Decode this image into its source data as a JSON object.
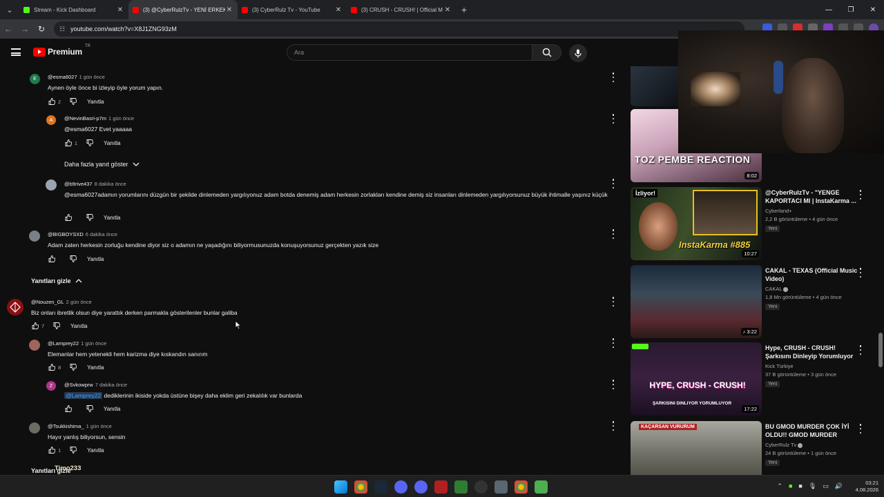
{
  "browser": {
    "tabs": [
      {
        "title": "Stream - Kick Dashboard",
        "favicon": "kick-icon",
        "active": false
      },
      {
        "title": "(3) @CyberRulzTv - YENİ ERKEK",
        "favicon": "youtube-icon",
        "active": true
      },
      {
        "title": "(3) CyberRulz Tv - YouTube",
        "favicon": "youtube-icon",
        "active": false
      },
      {
        "title": "(3) CRUSH - CRUSH! | Official M",
        "favicon": "youtube-icon",
        "active": false
      }
    ],
    "url": "youtube.com/watch?v=X8J1ZNG93zM"
  },
  "masthead": {
    "logo_word": "Premium",
    "country_code": "TR",
    "search_placeholder": "Ara"
  },
  "comments": [
    {
      "author": "@esma6027",
      "time": "1 gün önce",
      "text": "Aynen öyle önce bi izleyip öyle yorum yapın.",
      "likes": "2",
      "reply": "Yanıtla",
      "avatar_letter": "E",
      "avatar_color": "#1e7a4c"
    },
    {
      "author": "@NevinBasri-p7m",
      "time": "1 gün önce",
      "text": "@esma6027 Evet yaaaaa",
      "likes": "1",
      "reply": "Yanıtla",
      "avatar_letter": "A",
      "avatar_color": "#e0741f"
    },
    {
      "author": "@b9rive437",
      "time": "8 dakika önce",
      "text": "@esma6027adamın yorumlarını düzgün bir şekilde dinlemeden yargılıyonuz adam botda denemiş adam herkesin zorlakları kendine demiş siz insanları dinlemeden yargılıyorsunuz büyük ihtimalle yaşınız küçük",
      "likes": "",
      "reply": "Yanıtla"
    },
    {
      "author": "@BIGBOYSXD",
      "time": "6 dakika önce",
      "text": "Adam zaten herkesin zorluğu kendine diyor siz o adamın ne yaşadığını biliyormusunuzda konuşuyorsunuz gerçekten yazık size",
      "likes": "",
      "reply": "Yanıtla"
    },
    {
      "author": "@Nouzen_GL",
      "time": "2 gün önce",
      "text": "Biz onları ibretlik olsun diye yarattık derken parmakla gösterilenler bunlar galiba",
      "likes": "7",
      "reply": "Yanıtla"
    },
    {
      "author": "@Lamprey22",
      "time": "1 gün önce",
      "text": "Elemanlar hem yetenekli hem karizma diye kıskandın sanırım",
      "likes": "8",
      "reply": "Yanıtla"
    },
    {
      "author": "@Svkowprw",
      "time": "7 dakika önce",
      "mention": "@Lamprey22",
      "text": "dediklerinin ikiside yokda üstüne bişey daha eklim geri zekalılık var bunlarda",
      "likes": "",
      "reply": "Yanıtla",
      "avatar_letter": "Z",
      "avatar_color": "#b0338a"
    },
    {
      "author": "@Tsukkishima_",
      "time": "1 gün önce",
      "text": "Hayır yanlış biliyorsun, sensin",
      "likes": "1",
      "reply": "Yanıtla"
    }
  ],
  "toggles": {
    "more_replies": "Daha fazla yanıt göster",
    "hide_replies": "Yanıtları gizle",
    "hide_replies_bottom": "Yanıtları gizle",
    "overlay_name": "Timo233"
  },
  "sidebar": {
    "videos": [
      {
        "title": "",
        "channel": "",
        "stats": "",
        "duration": "8:02",
        "thumb_text": "TOZ PEMBE REACTION",
        "badge": ""
      },
      {
        "title": "@CyberRulzTv - \"YENGE KAPORTACI MI | InstaKarma ...",
        "channel": "Cyberland+",
        "stats": "2,2 B görüntüleme • 4 gün önce",
        "duration": "10:27",
        "thumb_text": "InstaKarma #885",
        "thumb_top": "İzliyor!",
        "badge": "Yeni"
      },
      {
        "title": "CAKAL - TEXAS (Official Music Video)",
        "channel": "CAKAL",
        "stats": "1,8 Mn görüntüleme • 4 gün önce",
        "duration": "3:22",
        "badge": "Yeni"
      },
      {
        "title": "Hype, CRUSH - CRUSH! Şarkısını Dinleyip Yorumluyor",
        "channel": "Kick Türkiye",
        "stats": "37 B görüntüleme • 3 gün önce",
        "duration": "17:22",
        "thumb_text": "HYPE, CRUSH - CRUSH!",
        "thumb_sub": "ŞARKISINI DINLIYOR YORUMLUYOR",
        "badge": "Yeni"
      },
      {
        "title": "BU GMOD MURDER ÇOK İYİ OLDU!! GMOD MURDER",
        "channel": "CyberRulz Tv",
        "stats": "24 B görüntüleme • 1 gün önce",
        "duration": "",
        "thumb_text": "KAÇARSAN VURURUM",
        "badge": "Yeni"
      }
    ]
  },
  "taskbar": {
    "time": "03:21",
    "date": "4.08.2026"
  }
}
